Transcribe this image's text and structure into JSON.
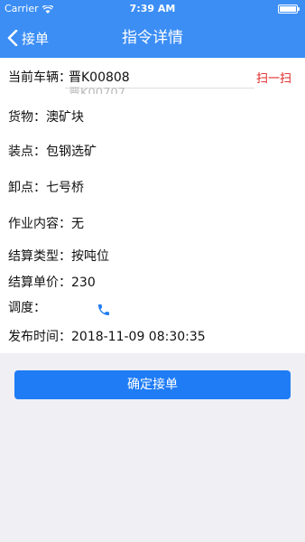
{
  "status_bar": {
    "carrier": "Carrier",
    "time": "7:39 AM"
  },
  "nav": {
    "back_label": "接单",
    "title": "指令详情"
  },
  "vehicle": {
    "label": "当前车辆：",
    "value": "晋K00808",
    "ghost_value": "晋K00707",
    "scan_label": "扫一扫"
  },
  "details": [
    {
      "label": "货物：",
      "value": "澳矿块"
    },
    {
      "label": "装点：",
      "value": "包钢选矿"
    },
    {
      "label": "卸点：",
      "value": "七号桥"
    },
    {
      "label": "作业内容：",
      "value": "无"
    },
    {
      "label": "结算类型：",
      "value": "按吨位"
    },
    {
      "label": "结算单价：",
      "value": "230"
    },
    {
      "label": "调度：",
      "value": ""
    },
    {
      "label": "发布时间：",
      "value": "2018-11-09 08:30:35"
    }
  ],
  "confirm_label": "确定接单",
  "colors": {
    "primary": "#3c8ef5",
    "button": "#1f7cf5",
    "scan": "#e02020",
    "phone": "#1f7cf5"
  }
}
